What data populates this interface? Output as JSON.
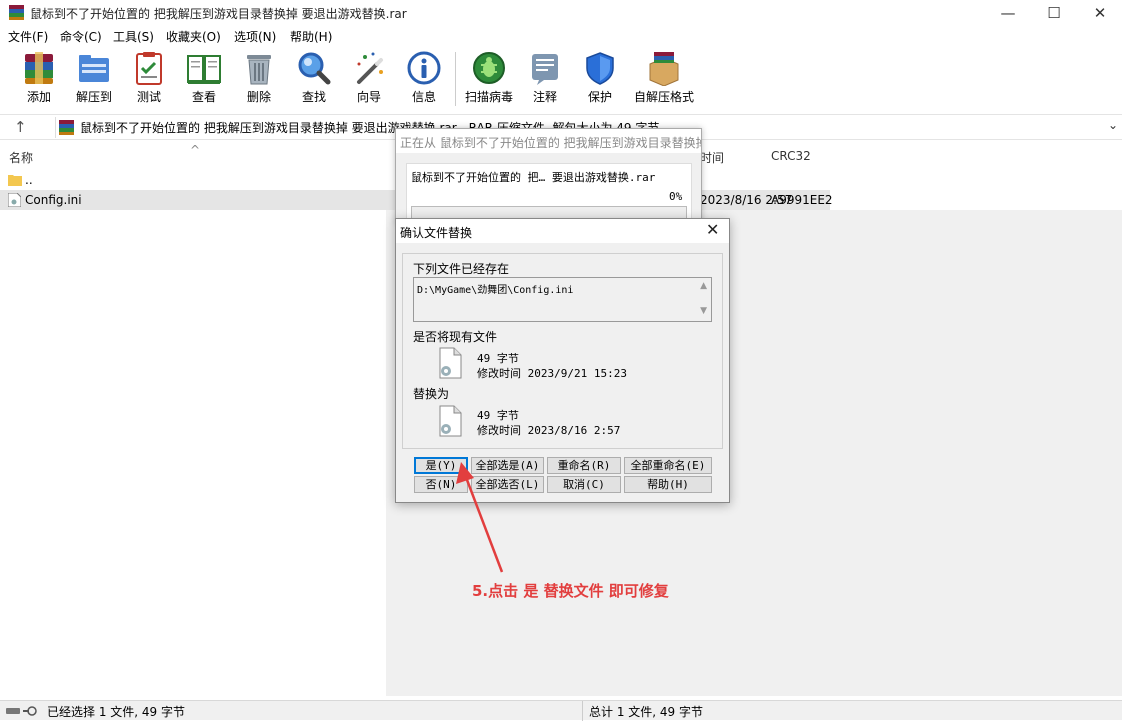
{
  "window": {
    "title": "鼠标到不了开始位置的 把我解压到游戏目录替换掉 要退出游戏替换.rar",
    "minimize": "—",
    "maximize": "☐",
    "close": "✕"
  },
  "menu": [
    "文件(F)",
    "命令(C)",
    "工具(S)",
    "收藏夹(O)",
    "选项(N)",
    "帮助(H)"
  ],
  "toolbar": {
    "add": "添加",
    "extract": "解压到",
    "test": "测试",
    "view": "查看",
    "delete": "删除",
    "find": "查找",
    "wizard": "向导",
    "info": "信息",
    "scan": "扫描病毒",
    "comment": "注释",
    "protect": "保护",
    "sfx": "自解压格式"
  },
  "address": {
    "up": "↑",
    "text": "鼠标到不了开始位置的 把我解压到游戏目录替换掉 要退出游戏替换.rar - RAR 压缩文件, 解包大小为 49 字节",
    "chevron": "⌄"
  },
  "columns": {
    "name": "名称",
    "sort_indicator": "^",
    "modified": "时间",
    "crc": "CRC32"
  },
  "files": [
    {
      "name": "..",
      "modified": "",
      "crc": ""
    },
    {
      "name": "Config.ini",
      "modified": "2023/8/16 2:57",
      "crc": "A9991EE2"
    }
  ],
  "progress_dialog": {
    "title": "正在从 鼠标到不了开始位置的 把我解压到游戏目录替换掉 要退出游戏替换.rar 中解压",
    "file": "鼠标到不了开始位置的 把… 要退出游戏替换.rar",
    "percent": "0%",
    "progress_fraction": 0
  },
  "confirm_dialog": {
    "title": "确认文件替换",
    "close": "✕",
    "exists_label": "下列文件已经存在",
    "path": "D:\\MyGame\\劲舞团\\Config.ini",
    "scroll_up": "▲",
    "scroll_down": "▼",
    "question": "是否将现有文件",
    "existing": {
      "size": "49 字节",
      "modified": "修改时间 2023/9/21 15:23"
    },
    "replace_label": "替换为",
    "new": {
      "size": "49 字节",
      "modified": "修改时间 2023/8/16 2:57"
    },
    "buttons": {
      "yes": "是(Y)",
      "yes_all": "全部选是(A)",
      "rename": "重命名(R)",
      "rename_all": "全部重命名(E)",
      "no": "否(N)",
      "no_all": "全部选否(L)",
      "cancel": "取消(C)",
      "help": "帮助(H)"
    }
  },
  "annotation": "5.点击 是 替换文件 即可修复",
  "status": {
    "left": "已经选择 1 文件, 49 字节",
    "right": "总计 1 文件, 49 字节"
  },
  "colors": {
    "annotation": "#e23e3e",
    "default_button_border": "#0078d7",
    "selection": "#e5e5e5"
  }
}
